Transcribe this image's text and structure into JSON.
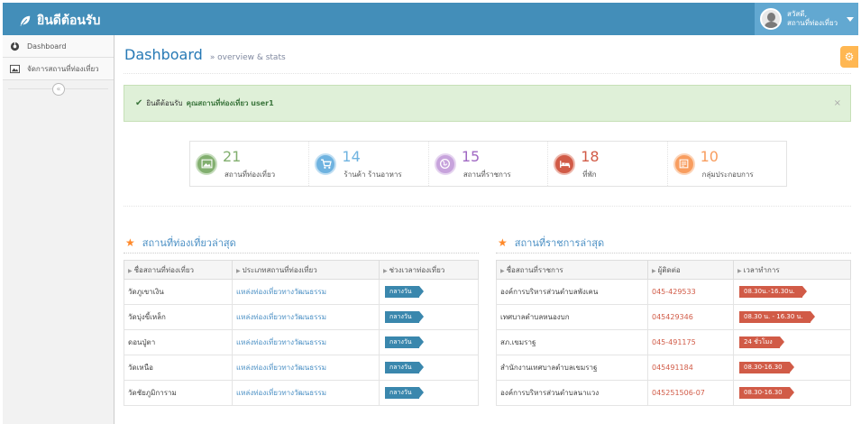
{
  "navbar": {
    "brand": "ยินดีต้อนรับ",
    "user_greeting": "สวัสดี,",
    "user_name": "สถานที่ท่องเที่ยว"
  },
  "sidebar": {
    "items": [
      {
        "label": "Dashboard",
        "icon": "dashboard-icon"
      },
      {
        "label": "จัดการสถานที่ท่องเที่ยว",
        "icon": "picture-icon"
      }
    ],
    "collapse_glyph": "«"
  },
  "header": {
    "title": "Dashboard",
    "subtitle": "» overview & stats"
  },
  "alert": {
    "text": "ยินดีต้อนรับ",
    "user": "คุณสถานที่ท่องเที่ยว user1",
    "close": "×"
  },
  "stats": [
    {
      "number": "21",
      "label": "สถานที่ท่องเที่ยว",
      "color": "#82af6f",
      "icon": "image-icon"
    },
    {
      "number": "14",
      "label": "ร้านค้า ร้านอาหาร",
      "color": "#6fb3e0",
      "icon": "cart-icon"
    },
    {
      "number": "15",
      "label": "สถานที่ราชการ",
      "color": "#c7a3dc",
      "icon": "globe-icon"
    },
    {
      "number": "18",
      "label": "ที่พัก",
      "color": "#d15b47",
      "icon": "bed-icon"
    },
    {
      "number": "10",
      "label": "กลุ่มประกอบการ",
      "color": "#f89d5f",
      "icon": "list-icon"
    }
  ],
  "attractions": {
    "title": "สถานที่ท่องเที่ยวล่าสุด",
    "headers": [
      "ชื่อสถานที่ท่องเที่ยว",
      "ประเภทสถานที่ท่องเที่ยว",
      "ช่วงเวลาท่องเที่ยว"
    ],
    "rows": [
      {
        "name": "วัดภูเขาเงิน",
        "type": "แหล่งท่องเที่ยวทางวัฒนธรรม",
        "time": "กลางวัน"
      },
      {
        "name": "วัดบุ่งขี้เหล็ก",
        "type": "แหล่งท่องเที่ยวทางวัฒนธรรม",
        "time": "กลางวัน"
      },
      {
        "name": "ดอนปู่ตา",
        "type": "แหล่งท่องเที่ยวทางวัฒนธรรม",
        "time": "กลางวัน"
      },
      {
        "name": "วัดเหนือ",
        "type": "แหล่งท่องเที่ยวทางวัฒนธรรม",
        "time": "กลางวัน"
      },
      {
        "name": "วัดชัยภูมิการาม",
        "type": "แหล่งท่องเที่ยวทางวัฒนธรรม",
        "time": "กลางวัน"
      }
    ]
  },
  "government": {
    "title": "สถานที่ราชการล่าสุด",
    "headers": [
      "ชื่อสถานที่ราชการ",
      "ผู้ติดต่อ",
      "เวลาทำการ"
    ],
    "rows": [
      {
        "name": "องค์การบริหารส่วนตำบลพังเคน",
        "contact": "045-429533",
        "hours": "08.30น.-16.30น."
      },
      {
        "name": "เทศบาลตำบลหนองบก",
        "contact": "045429346",
        "hours": "08.30 น. - 16.30 น."
      },
      {
        "name": "สภ.เขมราฐ",
        "contact": "045-491175",
        "hours": "24 ชั่วโมง"
      },
      {
        "name": "สำนักงานเทศบาลตำบลเขมราฐ",
        "contact": "045491184",
        "hours": "08.30-16.30"
      },
      {
        "name": "องค์การบริหารส่วนตำบลนาแวง",
        "contact": "045251506-07",
        "hours": "08.30-16.30"
      }
    ]
  }
}
